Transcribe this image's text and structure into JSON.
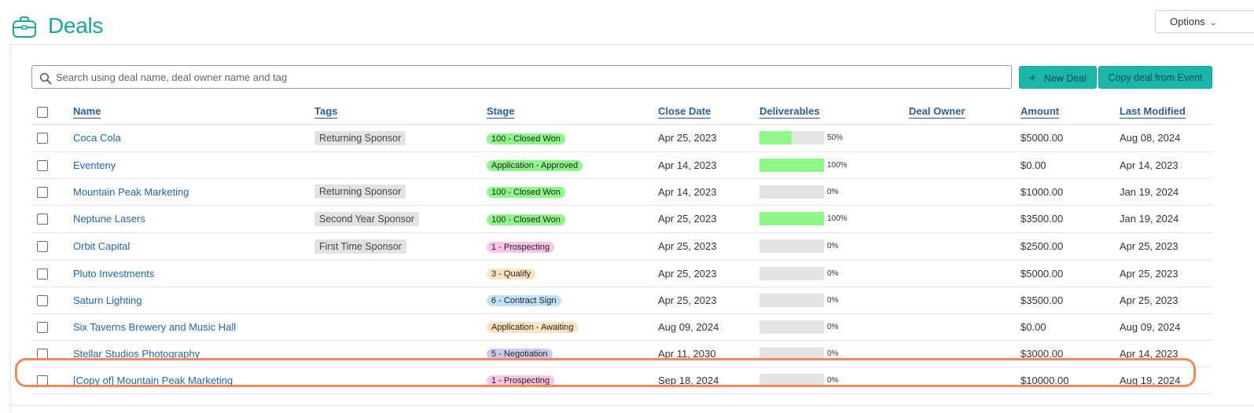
{
  "header": {
    "title": "Deals",
    "options_label": "Options",
    "accent": "#1aa79a"
  },
  "search": {
    "placeholder": "Search using deal name, deal owner name and tag",
    "value": ""
  },
  "actions": {
    "new_deal_label": "New Deal",
    "copy_deal_label": "Copy deal from Event"
  },
  "table": {
    "columns": [
      "Name",
      "Tags",
      "Stage",
      "Close Date",
      "Deliverables",
      "Deal Owner",
      "Amount",
      "Last Modified"
    ],
    "rows": [
      {
        "name": "Coca Cola",
        "tag": "Returning Sponsor",
        "stage": "100 - Closed Won",
        "stage_color": "#8ff78a",
        "close_date": "Apr 25, 2023",
        "deliverables": 50,
        "deliverables_label": "50%",
        "owner": "",
        "amount": "$5000.00",
        "modified": "Aug 08, 2024"
      },
      {
        "name": "Eventeny",
        "tag": "",
        "stage": "Application - Approved",
        "stage_color": "#8ff78a",
        "close_date": "Apr 14, 2023",
        "deliverables": 100,
        "deliverables_label": "100%",
        "owner": "",
        "amount": "$0.00",
        "modified": "Apr 14, 2023"
      },
      {
        "name": "Mountain Peak Marketing",
        "tag": "Returning Sponsor",
        "stage": "100 - Closed Won",
        "stage_color": "#8ff78a",
        "close_date": "Apr 14, 2023",
        "deliverables": 0,
        "deliverables_label": "0%",
        "owner": "",
        "amount": "$1000.00",
        "modified": "Jan 19, 2024"
      },
      {
        "name": "Neptune Lasers",
        "tag": "Second Year Sponsor",
        "stage": "100 - Closed Won",
        "stage_color": "#8ff78a",
        "close_date": "Apr 25, 2023",
        "deliverables": 100,
        "deliverables_label": "100%",
        "owner": "",
        "amount": "$3500.00",
        "modified": "Jan 19, 2024"
      },
      {
        "name": "Orbit Capital",
        "tag": "First Time Sponsor",
        "stage": "1 - Prospecting",
        "stage_color": "#f9c4e4",
        "close_date": "Apr 25, 2023",
        "deliverables": 0,
        "deliverables_label": "0%",
        "owner": "",
        "amount": "$2500.00",
        "modified": "Apr 25, 2023"
      },
      {
        "name": "Pluto Investments",
        "tag": "",
        "stage": "3 - Qualify",
        "stage_color": "#fde3c2",
        "close_date": "Apr 25, 2023",
        "deliverables": 0,
        "deliverables_label": "0%",
        "owner": "",
        "amount": "$5000.00",
        "modified": "Apr 25, 2023"
      },
      {
        "name": "Saturn Lighting",
        "tag": "",
        "stage": "6 - Contract Sign",
        "stage_color": "#bfe2fb",
        "close_date": "Apr 25, 2023",
        "deliverables": 0,
        "deliverables_label": "0%",
        "owner": "",
        "amount": "$3500.00",
        "modified": "Apr 25, 2023"
      },
      {
        "name": "Six Taverns Brewery and Music Hall",
        "tag": "",
        "stage": "Application - Awaiting",
        "stage_color": "#fde3c2",
        "close_date": "Aug 09, 2024",
        "deliverables": 0,
        "deliverables_label": "0%",
        "owner": "",
        "amount": "$0.00",
        "modified": "Aug 09, 2024"
      },
      {
        "name": "Stellar Studios Photography",
        "tag": "",
        "stage": "5 - Negotiation",
        "stage_color": "#cbcbef",
        "close_date": "Apr 11, 2030",
        "deliverables": 0,
        "deliverables_label": "0%",
        "owner": "",
        "amount": "$3000.00",
        "modified": "Apr 14, 2023"
      },
      {
        "name": "[Copy of] Mountain Peak Marketing",
        "tag": "",
        "stage": "1 - Prospecting",
        "stage_color": "#f9c4e4",
        "close_date": "Sep 18, 2024",
        "deliverables": 0,
        "deliverables_label": "0%",
        "owner": "",
        "amount": "$10000.00",
        "modified": "Aug 19, 2024"
      }
    ]
  },
  "highlight_color": "#f08a5a"
}
